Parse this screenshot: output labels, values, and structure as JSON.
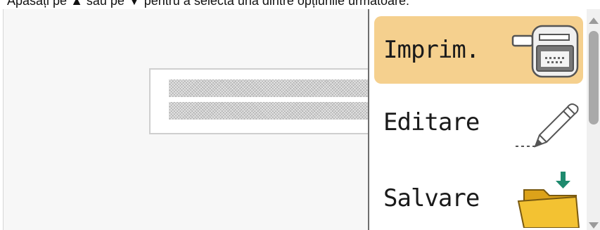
{
  "instruction": {
    "prefix": "Apăsați pe ",
    "key1": "▲",
    "middle": " sau pe ",
    "key2": "▼",
    "suffix": " pentru a selecta una dintre opțiunile următoare:"
  },
  "menu": {
    "items": [
      {
        "label": "Imprim.",
        "icon": "printer-icon",
        "selected": true
      },
      {
        "label": "Editare",
        "icon": "pencil-icon",
        "selected": false
      },
      {
        "label": "Salvare",
        "icon": "folder-save-icon",
        "selected": false
      }
    ]
  },
  "colors": {
    "selected_item_bg": "#f5d08e",
    "folder_yellow": "#f3c232",
    "arrow_green": "#1e8a6e",
    "scroll_thumb": "#a9a9a9"
  }
}
